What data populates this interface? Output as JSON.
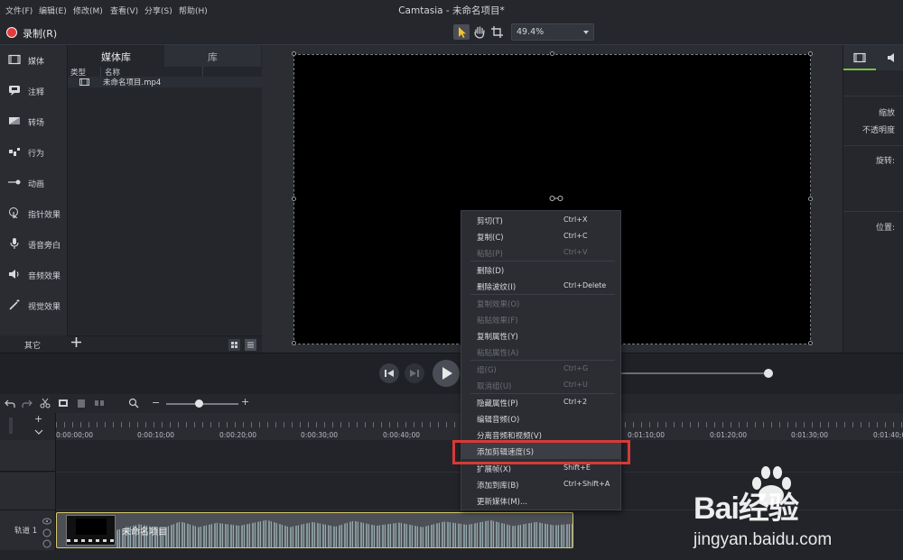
{
  "menubar": {
    "items": [
      "文件(F)",
      "编辑(E)",
      "修改(M)",
      "查看(V)",
      "分享(S)",
      "帮助(H)"
    ],
    "title": "Camtasia - 未命名项目*"
  },
  "toolbar": {
    "record_label": "录制(R)",
    "zoom_value": "49.4%"
  },
  "sidebar": {
    "items": [
      {
        "label": "媒体",
        "icon": "film-icon"
      },
      {
        "label": "注释",
        "icon": "annotation-icon"
      },
      {
        "label": "转场",
        "icon": "transition-icon"
      },
      {
        "label": "行为",
        "icon": "behavior-icon"
      },
      {
        "label": "动画",
        "icon": "animation-icon"
      },
      {
        "label": "指针效果",
        "icon": "cursor-icon"
      },
      {
        "label": "语音旁白",
        "icon": "microphone-icon"
      },
      {
        "label": "音频效果",
        "icon": "speaker-icon"
      },
      {
        "label": "视觉效果",
        "icon": "magic-wand-icon"
      }
    ],
    "more_label": "其它"
  },
  "bin": {
    "tab_media": "媒体库",
    "tab_library": "库",
    "col_type": "类型",
    "col_name": "名称",
    "file_name": "未命名项目.mp4"
  },
  "properties": {
    "scale_label": "缩放",
    "opacity_label": "不透明度",
    "rotation_label": "旋转:",
    "position_label": "位置:"
  },
  "timeline": {
    "ticks": [
      "0:00:00;00",
      "0:00:10;00",
      "0:00:20;00",
      "0:00:30;00",
      "0:00:40;00",
      "0:01:10;00",
      "0:01:20;00",
      "0:01:30;00",
      "0:01:40;00"
    ],
    "track_label": "轨道 1",
    "clip_label": "未命名项目"
  },
  "context_menu": {
    "items": [
      {
        "label": "剪切(T)",
        "shortcut": "Ctrl+X",
        "enabled": true
      },
      {
        "label": "复制(C)",
        "shortcut": "Ctrl+C",
        "enabled": true
      },
      {
        "label": "粘贴(P)",
        "shortcut": "Ctrl+V",
        "enabled": false
      },
      {
        "label": "删除(D)",
        "shortcut": "",
        "enabled": true
      },
      {
        "label": "删除波纹(I)",
        "shortcut": "Ctrl+Delete",
        "enabled": true
      },
      {
        "label": "复制效果(O)",
        "shortcut": "",
        "enabled": false
      },
      {
        "label": "粘贴效果(F)",
        "shortcut": "",
        "enabled": false
      },
      {
        "label": "复制属性(Y)",
        "shortcut": "",
        "enabled": true
      },
      {
        "label": "粘贴属性(A)",
        "shortcut": "",
        "enabled": false
      },
      {
        "label": "组(G)",
        "shortcut": "Ctrl+G",
        "enabled": false
      },
      {
        "label": "取消组(U)",
        "shortcut": "Ctrl+U",
        "enabled": false
      },
      {
        "label": "隐藏属性(P)",
        "shortcut": "Ctrl+2",
        "enabled": true
      },
      {
        "label": "编辑音频(O)",
        "shortcut": "",
        "enabled": true
      },
      {
        "label": "分离音频和视频(V)",
        "shortcut": "",
        "enabled": true
      },
      {
        "label": "添加剪辑速度(S)",
        "shortcut": "",
        "enabled": true
      },
      {
        "label": "扩展帧(X)",
        "shortcut": "Shift+E",
        "enabled": true
      },
      {
        "label": "添加到库(B)",
        "shortcut": "Ctrl+Shift+A",
        "enabled": true
      },
      {
        "label": "更新媒体(M)...",
        "shortcut": "",
        "enabled": true
      }
    ]
  },
  "watermark": {
    "brand": "Bai经验",
    "url": "jingyan.baidu.com"
  },
  "colors": {
    "record": "#e23b3b",
    "highlight_box": "#d63a37",
    "clip_border": "#d6c86a"
  }
}
